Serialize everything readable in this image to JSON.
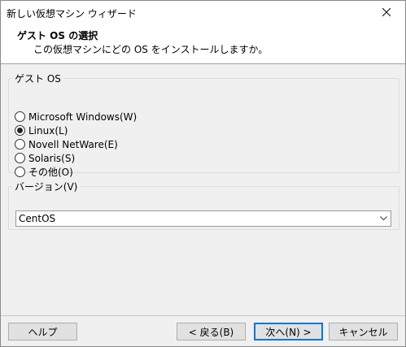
{
  "window": {
    "title": "新しい仮想マシン ウィザード"
  },
  "header": {
    "title": "ゲスト OS の選択",
    "subtitle": "この仮想マシンにどの OS をインストールしますか。"
  },
  "guest_os": {
    "legend": "ゲスト OS",
    "options": [
      {
        "label": "Microsoft Windows(W)",
        "checked": false
      },
      {
        "label": "Linux(L)",
        "checked": true
      },
      {
        "label": "Novell NetWare(E)",
        "checked": false
      },
      {
        "label": "Solaris(S)",
        "checked": false
      },
      {
        "label": "その他(O)",
        "checked": false
      }
    ]
  },
  "version": {
    "legend": "バージョン(V)",
    "selected": "CentOS"
  },
  "buttons": {
    "help": "ヘルプ",
    "back": "< 戻る(B)",
    "next": "次へ(N) >",
    "cancel": "キャンセル"
  },
  "icons": {
    "close": "close-icon",
    "dropdown": "chevron-down-icon"
  }
}
